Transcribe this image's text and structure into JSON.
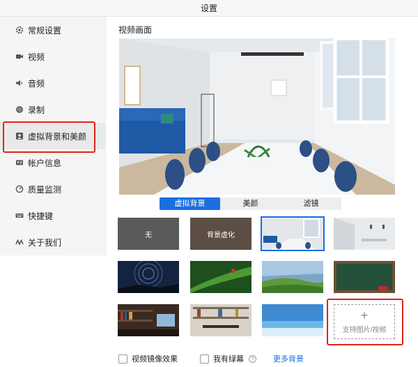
{
  "window": {
    "title": "设置"
  },
  "sidebar": {
    "items": [
      {
        "label": "常规设置",
        "icon": "gear-icon"
      },
      {
        "label": "视频",
        "icon": "video-camera-icon"
      },
      {
        "label": "音频",
        "icon": "speaker-icon"
      },
      {
        "label": "录制",
        "icon": "record-icon"
      },
      {
        "label": "虚拟背景和美颜",
        "icon": "portrait-icon",
        "active": true
      },
      {
        "label": "帐户信息",
        "icon": "id-card-icon"
      },
      {
        "label": "质量监测",
        "icon": "gauge-icon"
      },
      {
        "label": "快捷键",
        "icon": "keyboard-icon"
      },
      {
        "label": "关于我们",
        "icon": "logo-icon"
      }
    ]
  },
  "main": {
    "section_title": "视频画面",
    "tabs": [
      {
        "label": "虚拟背景",
        "active": true
      },
      {
        "label": "美颜"
      },
      {
        "label": "滤镜"
      }
    ],
    "backgrounds": [
      {
        "label": "无"
      },
      {
        "label": "背景虚化"
      },
      {
        "label": "",
        "selected": true
      },
      {
        "label": ""
      }
    ],
    "add_tile": {
      "label": "支持图片/视频"
    },
    "options": {
      "mirror_label": "视频镜像效果",
      "green_screen_label": "我有绿幕",
      "help_glyph": "?",
      "more_link": "更多背景"
    }
  },
  "colors": {
    "accent": "#1a6fe0",
    "highlight": "#e2231a"
  }
}
